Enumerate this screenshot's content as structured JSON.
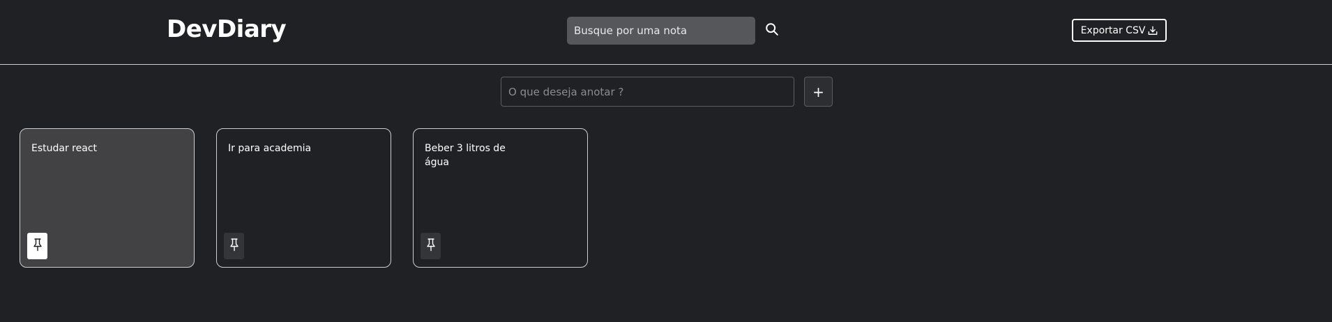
{
  "header": {
    "logo": "DevDiary",
    "search": {
      "placeholder": "Busque por uma nota",
      "icon": "search-icon"
    },
    "export_button": {
      "label": "Exportar CSV",
      "icon": "download-icon"
    }
  },
  "composer": {
    "placeholder": "O que deseja anotar ?",
    "add_label": "+"
  },
  "notes": [
    {
      "text": "Estudar react",
      "pinned": true
    },
    {
      "text": "Ir para academia",
      "pinned": false
    },
    {
      "text": "Beber 3 litros de água",
      "pinned": false
    }
  ],
  "colors": {
    "background": "#202125",
    "search_field": "#56575b",
    "active_card": "#424245",
    "pin_button": "#343539",
    "pin_button_active": "#ffffff",
    "text": "#ffffff"
  }
}
